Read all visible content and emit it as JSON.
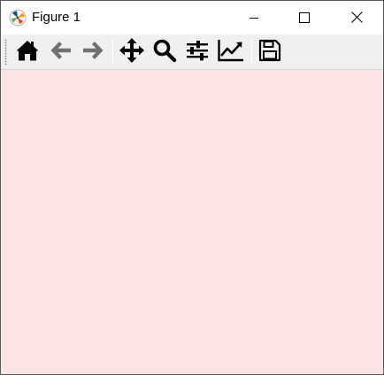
{
  "window": {
    "title": "Figure 1",
    "app_icon": "matplotlib-logo-icon",
    "controls": [
      {
        "name": "minimize",
        "icon": "minimize-icon"
      },
      {
        "name": "maximize",
        "icon": "maximize-icon"
      },
      {
        "name": "close",
        "icon": "close-icon"
      }
    ]
  },
  "toolbar": {
    "buttons": [
      {
        "name": "home",
        "icon": "home-icon"
      },
      {
        "name": "back",
        "icon": "arrow-left-icon",
        "enabled": false
      },
      {
        "name": "forward",
        "icon": "arrow-right-icon",
        "enabled": false
      },
      {
        "name": "pan",
        "icon": "move-icon"
      },
      {
        "name": "zoom",
        "icon": "magnifier-icon"
      },
      {
        "name": "configure-subplots",
        "icon": "sliders-icon"
      },
      {
        "name": "edit-axes",
        "icon": "line-chart-icon"
      },
      {
        "name": "save",
        "icon": "floppy-disk-icon"
      }
    ]
  },
  "canvas": {
    "background_color": "#fce4e3"
  },
  "colors": {
    "toolbar_bg": "#f0f0f0",
    "icon_active": "#000000",
    "icon_disabled": "#707070"
  }
}
